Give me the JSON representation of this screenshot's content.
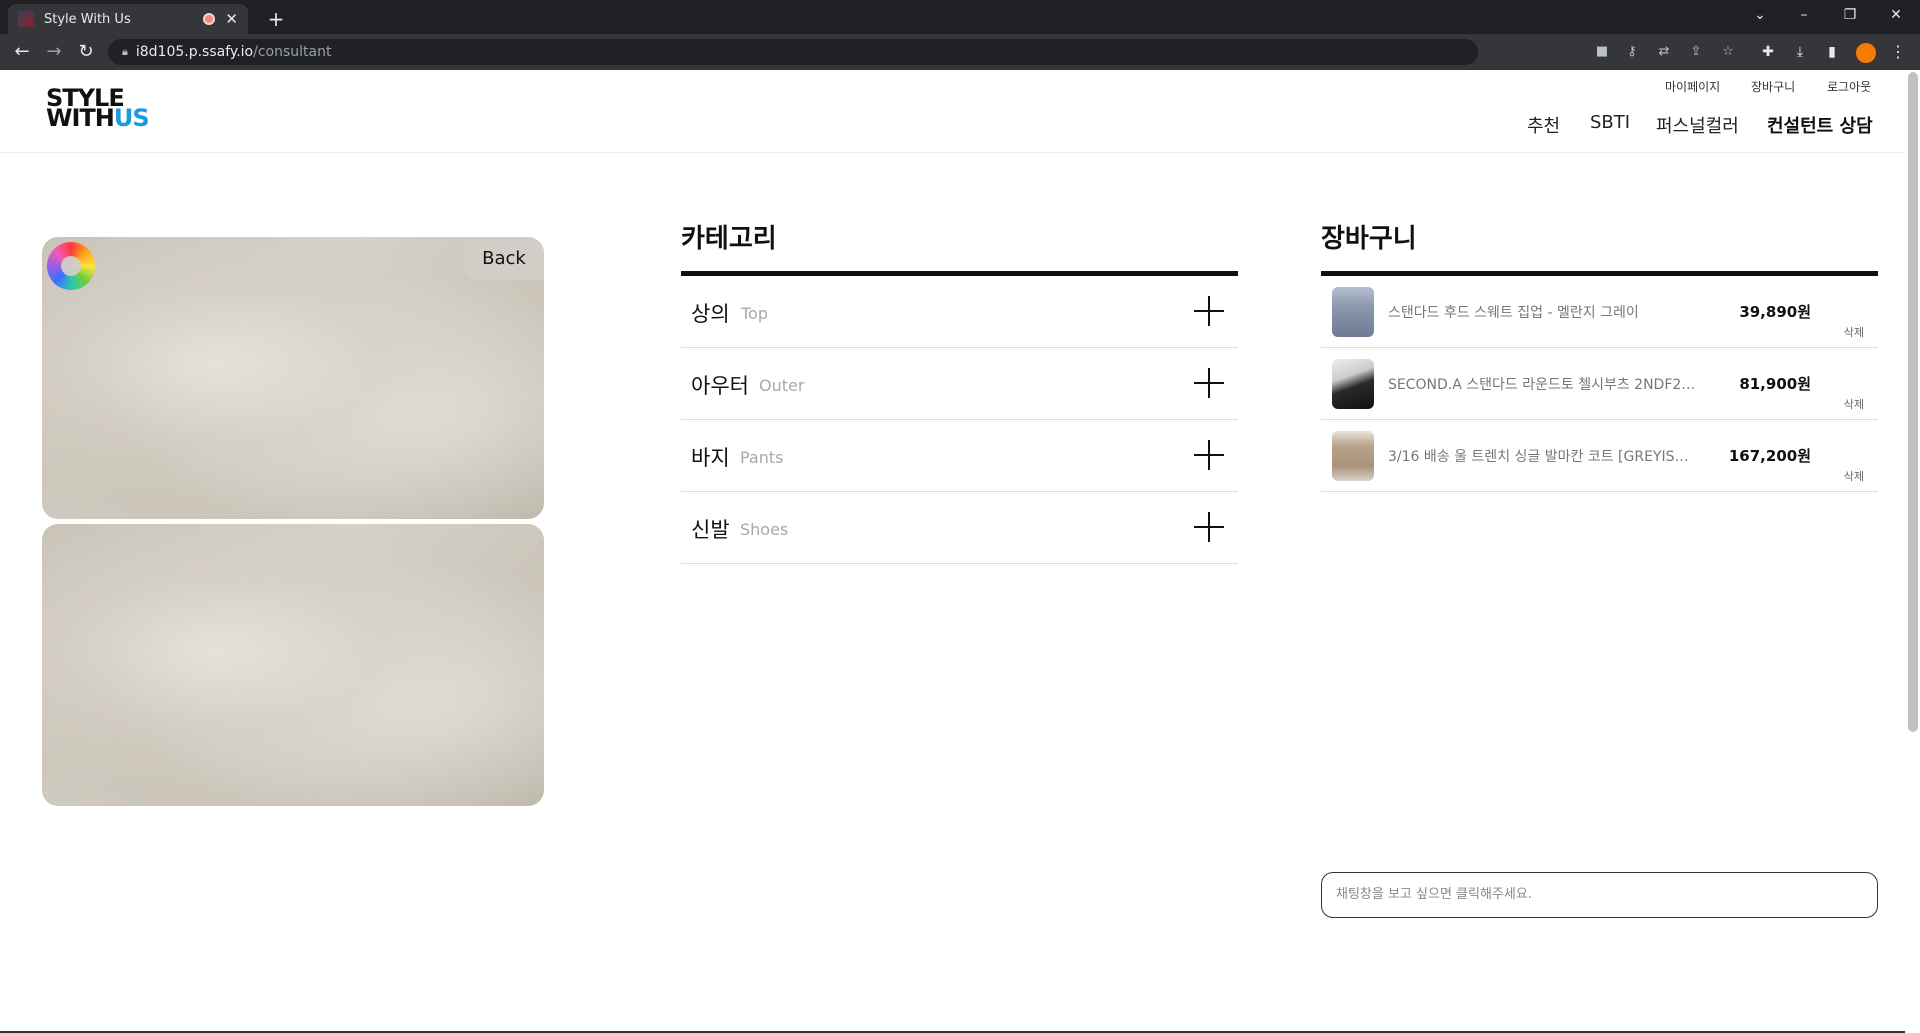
{
  "browser": {
    "tab_title": "Style With Us",
    "new_tab": "+",
    "url_host": "i8d105.p.ssafy.io",
    "url_path": "/consultant",
    "minimize": "–",
    "restore": "❐",
    "close": "✕"
  },
  "header": {
    "logo_line1": "STYLE",
    "logo_line2": "WITH",
    "logo_us": "US",
    "top_menu": [
      "마이페이지",
      "장바구니",
      "로그아웃"
    ],
    "nav": [
      "추천",
      "SBTI",
      "퍼스널컬러",
      "컨설턴트 상담"
    ],
    "active_nav": "컨설턴트 상담"
  },
  "video": {
    "back_label": "Back"
  },
  "category": {
    "title": "카테고리",
    "items": [
      {
        "ko": "상의",
        "en": "Top"
      },
      {
        "ko": "아우터",
        "en": "Outer"
      },
      {
        "ko": "바지",
        "en": "Pants"
      },
      {
        "ko": "신발",
        "en": "Shoes"
      }
    ]
  },
  "cart": {
    "title": "장바구니",
    "items": [
      {
        "name": "스탠다드 후드 스웨트 집업 - 멜란지 그레이",
        "price": "39,890원",
        "delete": "삭제",
        "thumb_color": "#8b97ad"
      },
      {
        "name": "SECOND.A 스탠다드 라운드토 첼시부츠 2NDF2…",
        "price": "81,900원",
        "delete": "삭제",
        "thumb_color": "#2a2a2a"
      },
      {
        "name": "3/16 배송 울 트렌치 싱글 발마칸 코트 [GREYIS…",
        "price": "167,200원",
        "delete": "삭제",
        "thumb_color": "#a8927a"
      }
    ]
  },
  "chat": {
    "placeholder": "채팅창을 보고 싶으면 클릭해주세요."
  }
}
